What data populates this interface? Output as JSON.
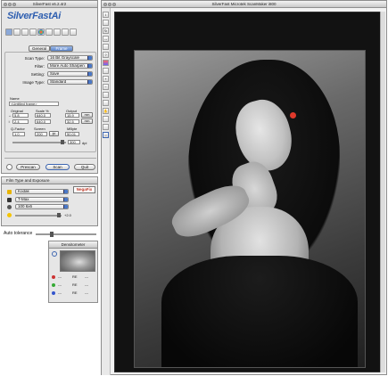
{
  "main_window": {
    "title": "SilverFast v6.2.4r2",
    "logo": "SilverFastAi",
    "tabs": [
      "General",
      "Frame"
    ],
    "scan_type_label": "Scan Type:",
    "scan_type_value": "16 Bit Grayscale",
    "filter_label": "Filter:",
    "filter_value": "More Auto Sharpen",
    "setting_label": "Setting:",
    "setting_value": "Save",
    "image_type_label": "Image Type:",
    "image_type_value": "Standard",
    "name_label": "Name",
    "name_value": "<Untitled frame>",
    "original_label": "Original",
    "scale_label": "Scale %",
    "output_label": "Output",
    "orig_w": "5.8",
    "orig_h": "2.4",
    "scale_w": "640.0",
    "scale_h": "640.0",
    "out_w": "15.9",
    "out_h": "32.5",
    "unit": "mm",
    "qfactor_label": "Q-Factor",
    "screen_label": "Screen",
    "mbyte_label": "MByte",
    "qfactor_value": "1.0",
    "screen_value": "200",
    "res_unit": "lpi",
    "mbyte_value": "50.01",
    "dpi_value": "300",
    "dpi_unit": "dpi",
    "buttons": {
      "prescan": "Prescan",
      "scan": "Scan",
      "quit": "Quit"
    }
  },
  "film_panel": {
    "title": "Film Type and Exposure",
    "badge": "NegaFix",
    "brand": "Kodak",
    "film": "T-Max",
    "iso": "100 6x6",
    "exposure": "+2.0"
  },
  "auto_tolerance_label": "Auto tolerance",
  "densitometer": {
    "title": "Densitometer",
    "rows": [
      {
        "color": "#cc3333",
        "a": "---",
        "b": "RE",
        "c": "---"
      },
      {
        "color": "#33aa33",
        "a": "---",
        "b": "RE",
        "c": "---"
      },
      {
        "color": "#3355cc",
        "a": "---",
        "b": "RE",
        "c": "---"
      }
    ]
  },
  "preview_window": {
    "title": "SilverFast Microtek ScanMaker i800"
  },
  "colors": {
    "accent": "#4a78c8",
    "target": "#e0392b",
    "film_bg": "#0d0d0d"
  }
}
